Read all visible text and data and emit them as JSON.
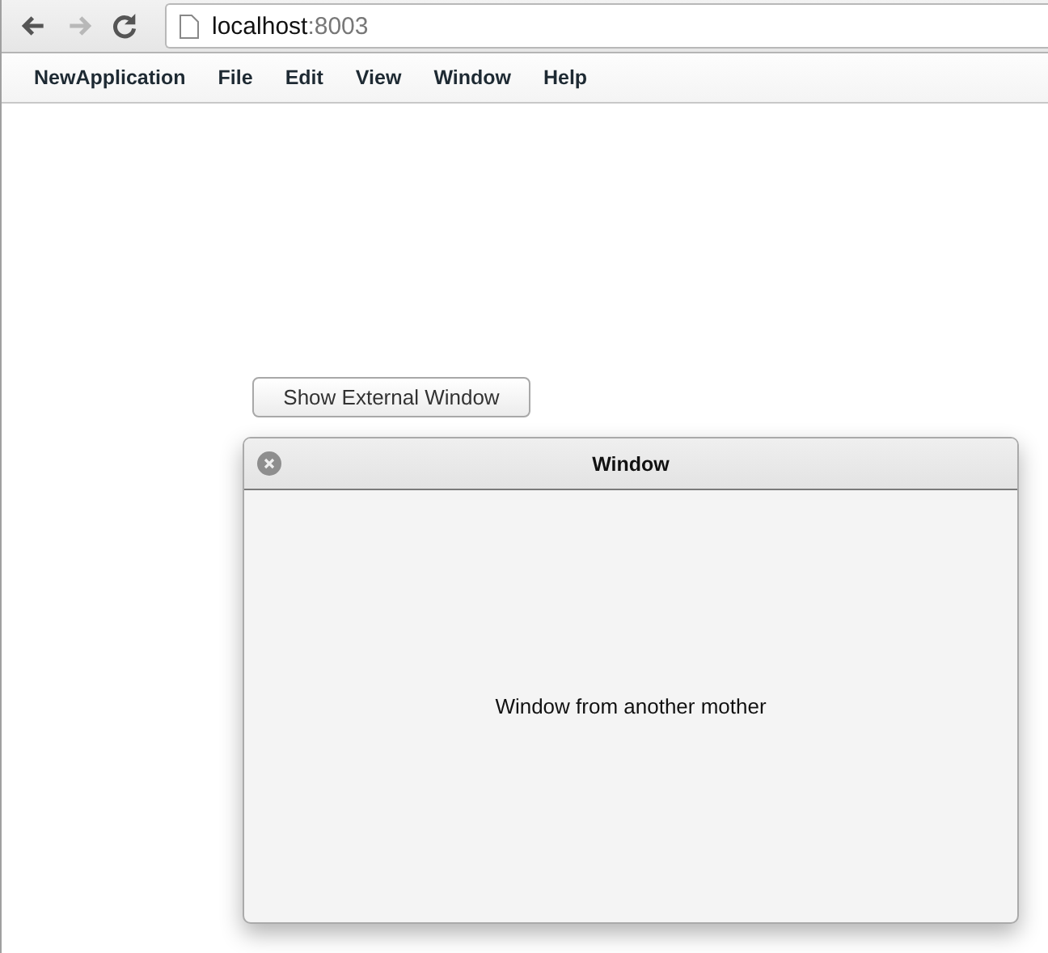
{
  "browser": {
    "nav": [
      {
        "kind": "back",
        "disabled": false
      },
      {
        "kind": "forward",
        "disabled": true
      },
      {
        "kind": "reload",
        "disabled": false
      }
    ],
    "address": {
      "host": "localhost",
      "rest": ":8003"
    }
  },
  "menu_bar": {
    "items": [
      "NewApplication",
      "File",
      "Edit",
      "View",
      "Window",
      "Help"
    ]
  },
  "show_button": "Show External Window",
  "window": {
    "title": "Window",
    "body": "Window from another mother"
  }
}
